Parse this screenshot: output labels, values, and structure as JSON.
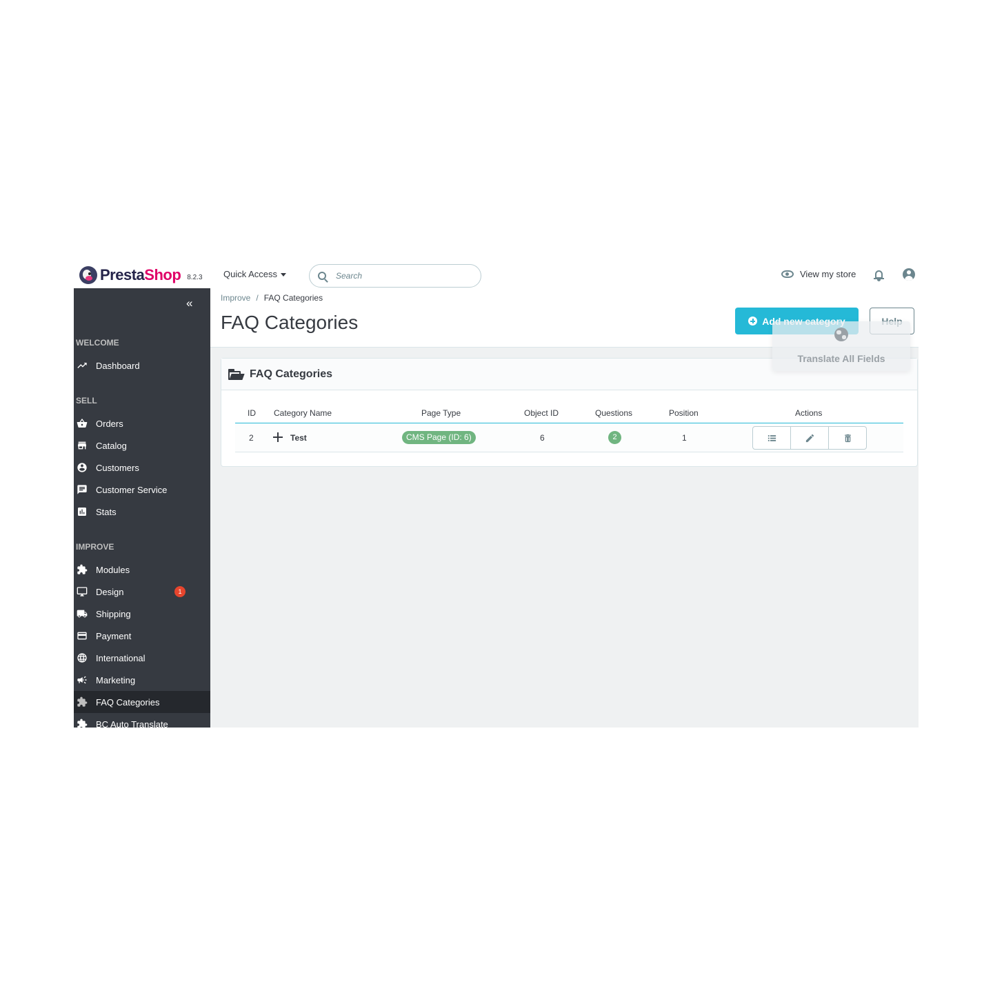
{
  "header": {
    "logo_brand": "Presta",
    "logo_brand_accent": "Shop",
    "version": "8.2.3",
    "quick_access_label": "Quick Access",
    "search_placeholder": "Search",
    "view_store_label": "View my store"
  },
  "sidebar": {
    "collapse_glyph": "«",
    "sections": [
      {
        "title": "WELCOME",
        "items": [
          {
            "label": "Dashboard",
            "icon": "trending-up-icon"
          }
        ]
      },
      {
        "title": "SELL",
        "items": [
          {
            "label": "Orders",
            "icon": "basket-icon"
          },
          {
            "label": "Catalog",
            "icon": "store-icon"
          },
          {
            "label": "Customers",
            "icon": "account-circle-icon"
          },
          {
            "label": "Customer Service",
            "icon": "chat-icon"
          },
          {
            "label": "Stats",
            "icon": "bar-chart-icon"
          }
        ]
      },
      {
        "title": "IMPROVE",
        "items": [
          {
            "label": "Modules",
            "icon": "puzzle-icon"
          },
          {
            "label": "Design",
            "icon": "desktop-icon",
            "badge": "1"
          },
          {
            "label": "Shipping",
            "icon": "truck-icon"
          },
          {
            "label": "Payment",
            "icon": "credit-card-icon"
          },
          {
            "label": "International",
            "icon": "globe-icon"
          },
          {
            "label": "Marketing",
            "icon": "megaphone-icon"
          },
          {
            "label": "FAQ Categories",
            "icon": "puzzle-icon",
            "active": true
          },
          {
            "label": "BC Auto Translate",
            "icon": "puzzle-icon"
          }
        ]
      }
    ]
  },
  "breadcrumb": {
    "parent": "Improve",
    "separator": "/",
    "current": "FAQ Categories"
  },
  "page_title": "FAQ Categories",
  "toolbar": {
    "add_label": "Add new category",
    "help_label": "Help"
  },
  "translate_overlay": {
    "label": "Translate All Fields"
  },
  "card": {
    "title": "FAQ Categories",
    "columns": {
      "id": "ID",
      "name": "Category Name",
      "page_type": "Page Type",
      "object_id": "Object ID",
      "questions": "Questions",
      "position": "Position",
      "actions": "Actions"
    },
    "rows": [
      {
        "id": "2",
        "name": "Test",
        "page_type": "CMS Page (ID: 6)",
        "object_id": "6",
        "questions": "2",
        "position": "1"
      }
    ]
  },
  "colors": {
    "primary": "#25b9d7",
    "sidebar_bg": "#363a41",
    "success": "#70b580",
    "danger_badge": "#e7452d"
  }
}
